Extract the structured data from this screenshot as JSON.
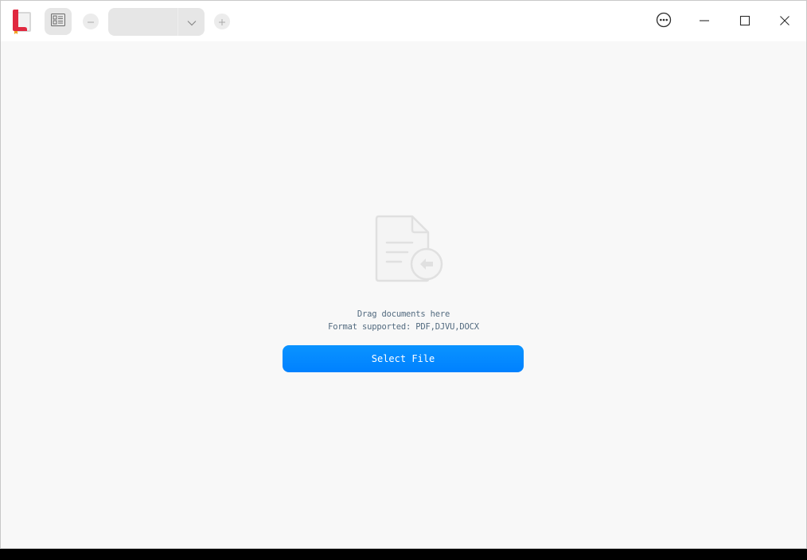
{
  "toolbar": {
    "zoom_value": ""
  },
  "empty_state": {
    "line1": "Drag documents here",
    "line2": "Format supported: PDF,DJVU,DOCX",
    "button_label": "Select File"
  },
  "icons": {
    "app_logo": "document-viewer-logo",
    "thumbnails": "thumbnails-icon",
    "zoom_out": "minus-icon",
    "zoom_in": "plus-icon",
    "dropdown": "chevron-down-icon",
    "menu": "more-icon",
    "minimize": "minimize-icon",
    "maximize": "maximize-icon",
    "close": "close-icon",
    "placeholder": "document-import-icon"
  },
  "colors": {
    "accent": "#0081ff",
    "logo_red": "#e0283f",
    "background": "#f8f8f8"
  }
}
